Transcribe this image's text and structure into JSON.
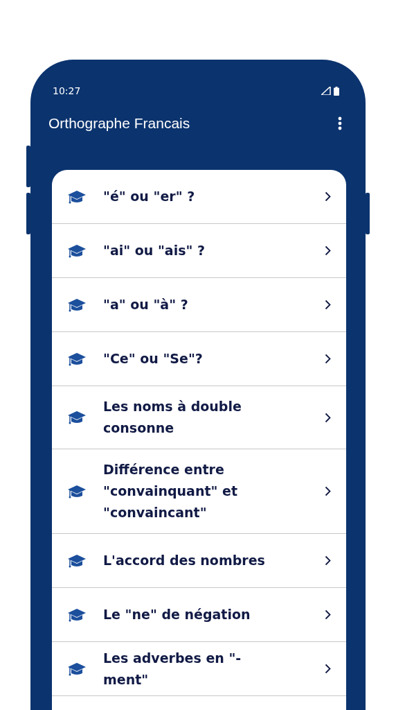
{
  "status_bar": {
    "time": "10:27"
  },
  "app_bar": {
    "title": "Orthographe Francais"
  },
  "lessons": [
    {
      "title": "\"é\" ou \"er\" ?"
    },
    {
      "title": "\"ai\" ou \"ais\" ?"
    },
    {
      "title": "\"a\" ou \"à\" ?"
    },
    {
      "title": "\"Ce\" ou \"Se\"?"
    },
    {
      "title": "Les noms à double consonne"
    },
    {
      "title": "Différence entre \"convainquant\" et \"convaincant\""
    },
    {
      "title": "L'accord des nombres"
    },
    {
      "title": "Le \"ne\" de négation"
    },
    {
      "title": "Les adverbes en \"-ment\""
    }
  ]
}
